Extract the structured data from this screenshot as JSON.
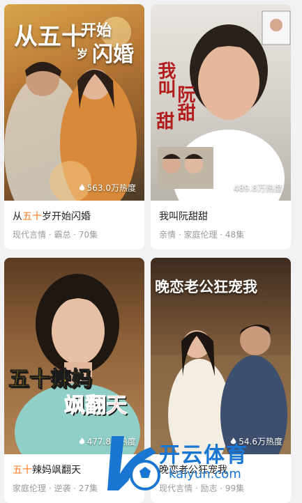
{
  "cards": [
    {
      "title_full": "从五十岁开始闪婚",
      "title_part1": "从",
      "title_highlight": "五十",
      "title_part2": "岁开始闪婚",
      "tags": "现代言情 · 霸总 · 70集",
      "hot": "563.0万热度",
      "poster_text_a": "从五十",
      "poster_text_b": "开始",
      "poster_text_c": "闪婚",
      "poster_text_d": "岁"
    },
    {
      "title": "我叫阮甜甜",
      "tags": "亲情 · 家庭伦理 · 48集",
      "hot": "489.8万热度",
      "poster_text_a": "我叫",
      "poster_text_b": "阮甜",
      "poster_text_c": "甜"
    },
    {
      "title_highlight": "五十",
      "title_rest": "辣妈飒翻天",
      "tags": "家庭伦理 · 逆袭 · 27集",
      "hot": "477.8万热度",
      "poster_text_a": "五十辣妈",
      "poster_text_b": "飒翻天"
    },
    {
      "title": "晚恋老公狂宠我",
      "tags": "现代言情 · 励志 · 99集",
      "hot": "54.6万热度",
      "poster_text_a": "晚恋老公狂宠我"
    }
  ],
  "watermark": {
    "brand": "开云体育",
    "url": "kaiyun.com"
  },
  "colors": {
    "highlight": "#ff7a1a",
    "accent_blue": "#1976d2"
  }
}
